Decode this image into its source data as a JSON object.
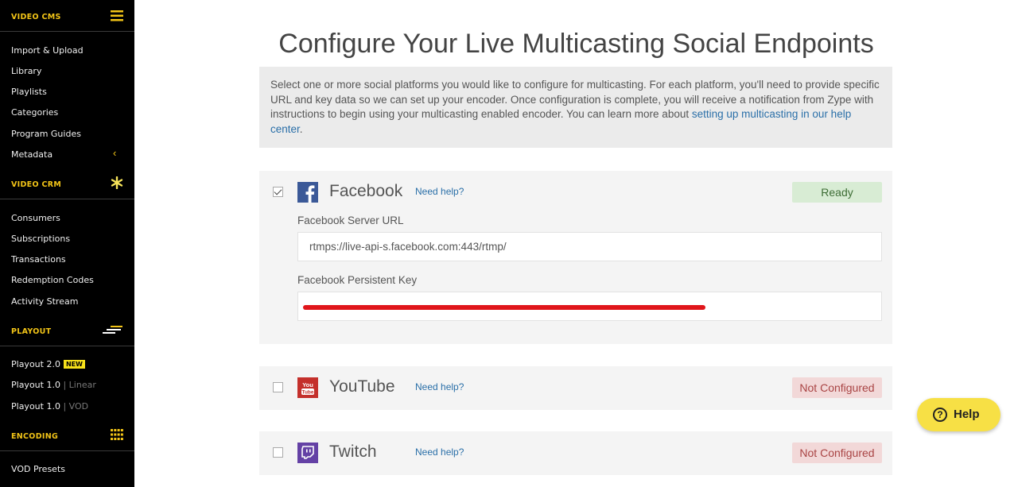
{
  "sidebar": {
    "sections": [
      {
        "title": "VIDEO CMS",
        "icon": "hamburger-menu-icon"
      },
      {
        "title": "VIDEO CRM",
        "icon": "asterisk-icon"
      },
      {
        "title": "PLAYOUT",
        "icon": "playout-lines-icon"
      },
      {
        "title": "ENCODING",
        "icon": "grid-dots-icon"
      }
    ],
    "cms_items": [
      "Import & Upload",
      "Library",
      "Playlists",
      "Categories",
      "Program Guides",
      "Metadata"
    ],
    "crm_items": [
      "Consumers",
      "Subscriptions",
      "Transactions",
      "Redemption Codes",
      "Activity Stream"
    ],
    "playout_items": [
      {
        "label": "Playout 2.0",
        "badge": "NEW",
        "suffix": ""
      },
      {
        "label": "Playout 1.0",
        "badge": "",
        "suffix": "Linear"
      },
      {
        "label": "Playout 1.0",
        "badge": "",
        "suffix": "VOD"
      }
    ],
    "encoding_items": [
      "VOD Presets"
    ],
    "accent_color": "#f2c417"
  },
  "main": {
    "title": "Configure Your Live Multicasting Social Endpoints",
    "intro": {
      "text": "Select one or more social platforms you would like to configure for multicasting. For each platform, you'll need to provide specific URL and key data so we can set up your encoder. Once configuration is complete, you will receive a notification from Zype with instructions to begin using your multicasting enabled encoder. You can learn more about ",
      "link": "setting up multicasting in our help center",
      "after": "."
    },
    "platforms": [
      {
        "name": "Facebook",
        "icon": "facebook-icon",
        "checked": true,
        "help": "Need help?",
        "status": "Ready",
        "server_url_label": "Facebook Server URL",
        "server_url_value": "rtmps://live-api-s.facebook.com:443/rtmp/",
        "key_label": "Facebook Persistent Key"
      },
      {
        "name": "YouTube",
        "icon": "youtube-icon",
        "checked": false,
        "help": "Need help?",
        "status": "Not Configured"
      },
      {
        "name": "Twitch",
        "icon": "twitch-icon",
        "checked": false,
        "help": "Need help?",
        "status": "Not Configured"
      }
    ]
  },
  "help_button": {
    "label": "Help",
    "icon": "question-circle-icon"
  }
}
